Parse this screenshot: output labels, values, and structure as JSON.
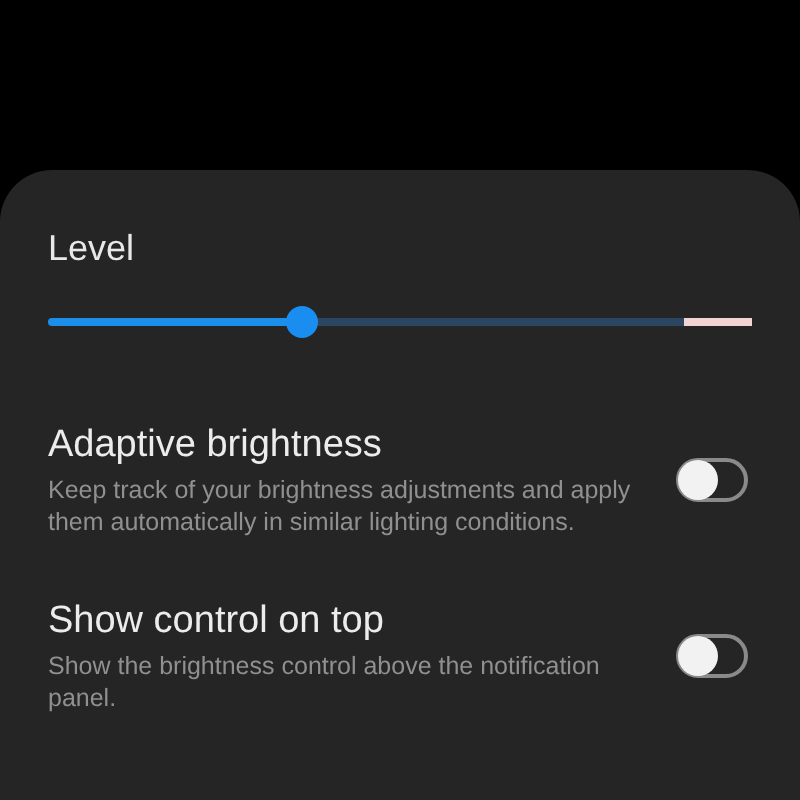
{
  "level_section": {
    "title": "Level",
    "slider": {
      "level": 0.36
    }
  },
  "settings": [
    {
      "title": "Adaptive brightness",
      "description": "Keep track of your brightness adjustments and apply them automatically in similar lighting conditions.",
      "on": false
    },
    {
      "title": "Show control on top",
      "description": "Show the brightness control above the notification panel.",
      "on": false
    }
  ]
}
